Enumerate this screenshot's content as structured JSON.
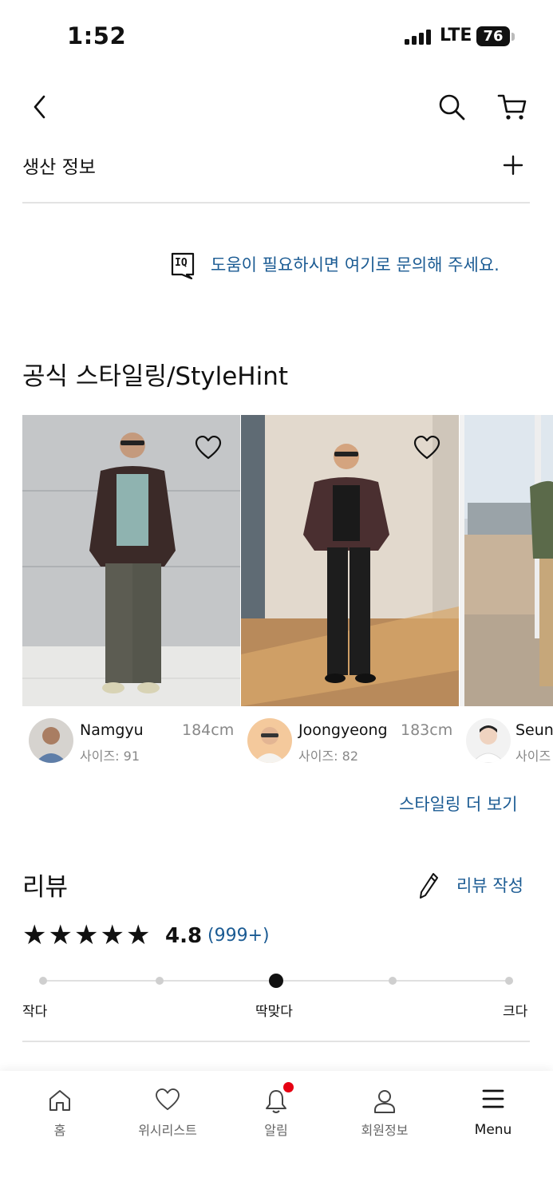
{
  "status_bar": {
    "time": "1:52",
    "network": "LTE",
    "battery": "76"
  },
  "production_info": {
    "label": "생산 정보"
  },
  "help": {
    "badge": "IQ",
    "text": "도움이 필요하시면 여기로 문의해 주세요."
  },
  "styling": {
    "title": "공식 스타일링/StyleHint",
    "models": [
      {
        "name": "Namgyu",
        "height": "184cm",
        "size": "사이즈: 91"
      },
      {
        "name": "Joongyeong",
        "height": "183cm",
        "size": "사이즈: 82"
      },
      {
        "name": "Seun",
        "height": "",
        "size": "사이즈"
      }
    ],
    "more_link": "스타일링 더 보기"
  },
  "review": {
    "title": "리뷰",
    "write_label": "리뷰 작성",
    "rating": "4.8",
    "count": "(999+)",
    "stars_filled": 5,
    "fit": {
      "small": "작다",
      "fit": "딱맞다",
      "large": "크다",
      "selected_index": 2,
      "levels": 5
    }
  },
  "bottom_nav": [
    {
      "label": "홈",
      "icon": "home-icon"
    },
    {
      "label": "위시리스트",
      "icon": "heart-icon"
    },
    {
      "label": "알림",
      "icon": "bell-icon"
    },
    {
      "label": "회원정보",
      "icon": "user-icon"
    },
    {
      "label": "Menu",
      "icon": "menu-icon"
    }
  ],
  "colors": {
    "accent_blue": "#1b5b93",
    "notification_dot": "#e60012"
  }
}
